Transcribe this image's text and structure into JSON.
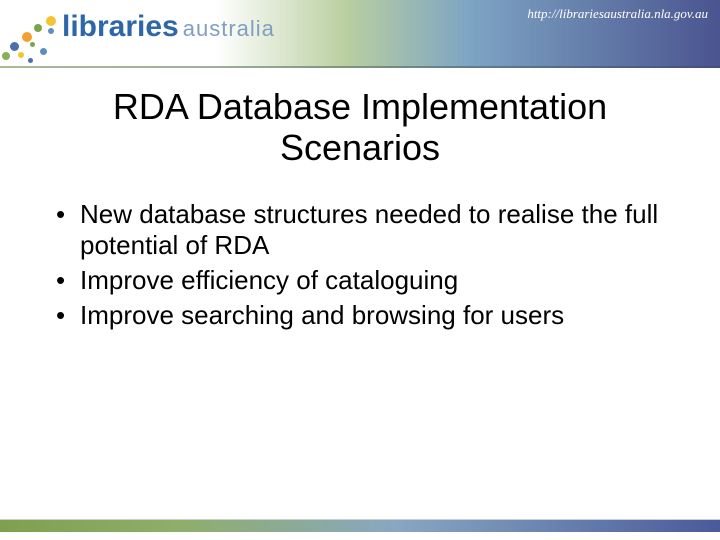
{
  "header": {
    "logo_main": "libraries",
    "logo_sub": "australia",
    "url": "http://librariesaustralia.nla.gov.au"
  },
  "slide": {
    "title": "RDA Database Implementation Scenarios",
    "bullets": [
      "New database structures needed to realise the full potential of RDA",
      "Improve efficiency of cataloguing",
      "Improve searching and browsing for users"
    ]
  }
}
